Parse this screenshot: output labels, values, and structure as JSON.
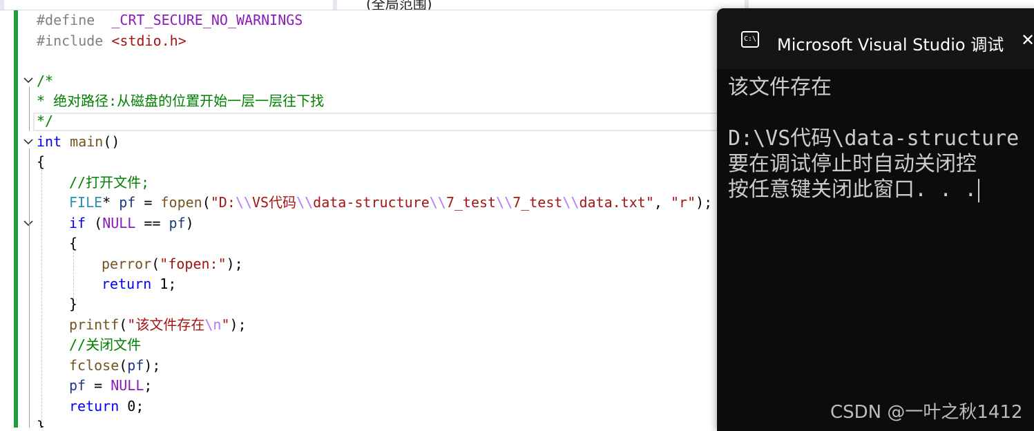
{
  "top_tab": {
    "text": "(全局范围)"
  },
  "editor": {
    "lines": {
      "l1": {
        "kw": "#define",
        "name": "_CRT_SECURE_NO_WARNINGS"
      },
      "l2": {
        "kw": "#include",
        "hdr": "<stdio.h>"
      },
      "l4": "/*",
      "l5": "* 绝对路径:从磁盘的位置开始一层一层往下找",
      "l6": "*/",
      "l7": {
        "type": "int",
        "fn": "main",
        "rest": "()"
      },
      "l8": "{",
      "l9": "//打开文件;",
      "l10": {
        "type": "FILE",
        "star": "*",
        "var": "pf",
        "eq": " = ",
        "fn": "fopen",
        "open": "(",
        "s1a": "\"D:",
        "e1": "\\\\",
        "s1b": "VS代码",
        "e2": "\\\\",
        "s1c": "data-structure",
        "e3": "\\\\",
        "s1d": "7_test",
        "e4": "\\\\",
        "s1e": "7_test",
        "e5": "\\\\",
        "s1f": "data.txt\"",
        "comma": ", ",
        "s2": "\"r\"",
        "close": ");"
      },
      "l11": {
        "kw": "if",
        "open": " (",
        "macro": "NULL",
        "op": " == ",
        "var": "pf",
        "close": ")"
      },
      "l12": "{",
      "l13": {
        "fn": "perror",
        "open": "(",
        "str": "\"fopen:\"",
        "close": ");"
      },
      "l14": {
        "kw": "return",
        "rest": " 1;"
      },
      "l15": "}",
      "l16": {
        "fn": "printf",
        "open": "(",
        "s1": "\"该文件存在",
        "esc": "\\n",
        "s2": "\"",
        "close": ");"
      },
      "l17": "//关闭文件",
      "l18": {
        "fn": "fclose",
        "open": "(",
        "var": "pf",
        "close": ");"
      },
      "l19": {
        "var": "pf",
        "eq": " = ",
        "macro": "NULL",
        "close": ";"
      },
      "l20": {
        "kw": "return",
        "rest": " 0;"
      },
      "l21": "}"
    }
  },
  "console": {
    "title": "Microsoft Visual Studio 调试",
    "icon": "terminal-icon",
    "icon_text": "C:\\",
    "close_glyph": "✕",
    "output": [
      "该文件存在",
      "",
      "D:\\VS代码\\data-structure",
      "要在调试停止时自动关闭控",
      "按任意键关闭此窗口. . ."
    ]
  },
  "watermark": "CSDN @一叶之秋1412",
  "colors": {
    "keyword": "#0000ff",
    "comment": "#008000",
    "string": "#a31515",
    "macro": "#8a1bbd",
    "function": "#74531f",
    "type": "#2b91af",
    "console_bg": "#0c0c0c",
    "change_bar": "#1f9d3a"
  }
}
